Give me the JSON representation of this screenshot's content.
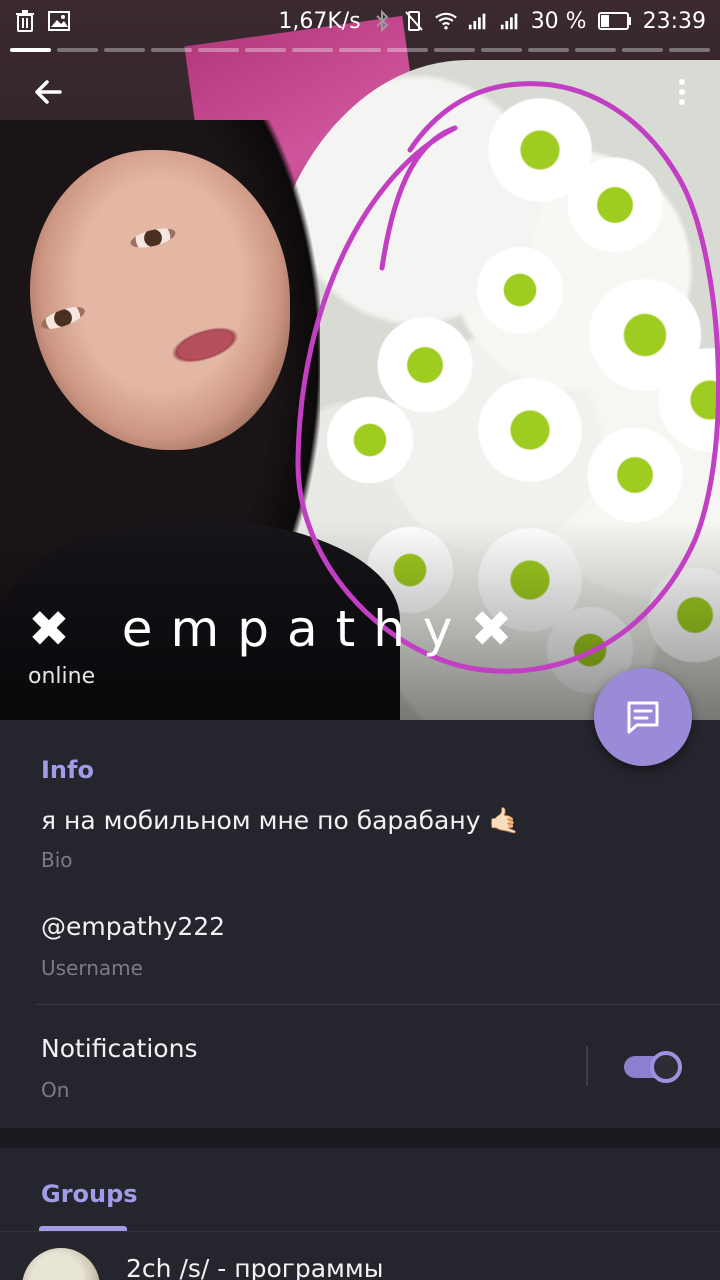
{
  "status_bar": {
    "speed": "1,67K/s",
    "battery_percent": "30 %",
    "time": "23:39",
    "icons": [
      "trash-icon",
      "image-icon",
      "bluetooth-icon",
      "vibrate-off-icon",
      "wifi-icon",
      "signal-icon",
      "signal-icon",
      "battery-icon"
    ]
  },
  "story": {
    "segments_total": 15,
    "active_segment": 1
  },
  "profile": {
    "name": "✖ empathy✖",
    "status": "online"
  },
  "info": {
    "section_title": "Info",
    "bio_text": "я на мобильном мне по барабану 🤙🏻",
    "bio_label": "Bio",
    "username_text": "@empathy222",
    "username_label": "Username",
    "notifications_title": "Notifications",
    "notifications_state": "On",
    "notifications_enabled": true
  },
  "groups": {
    "tab_label": "Groups",
    "items": [
      {
        "name": "2ch /s/ - программы"
      }
    ]
  },
  "colors": {
    "accent": "#a39ae8",
    "fab": "#9a8ad8",
    "card_bg": "#25252d",
    "annotation": "#c23ec2"
  }
}
